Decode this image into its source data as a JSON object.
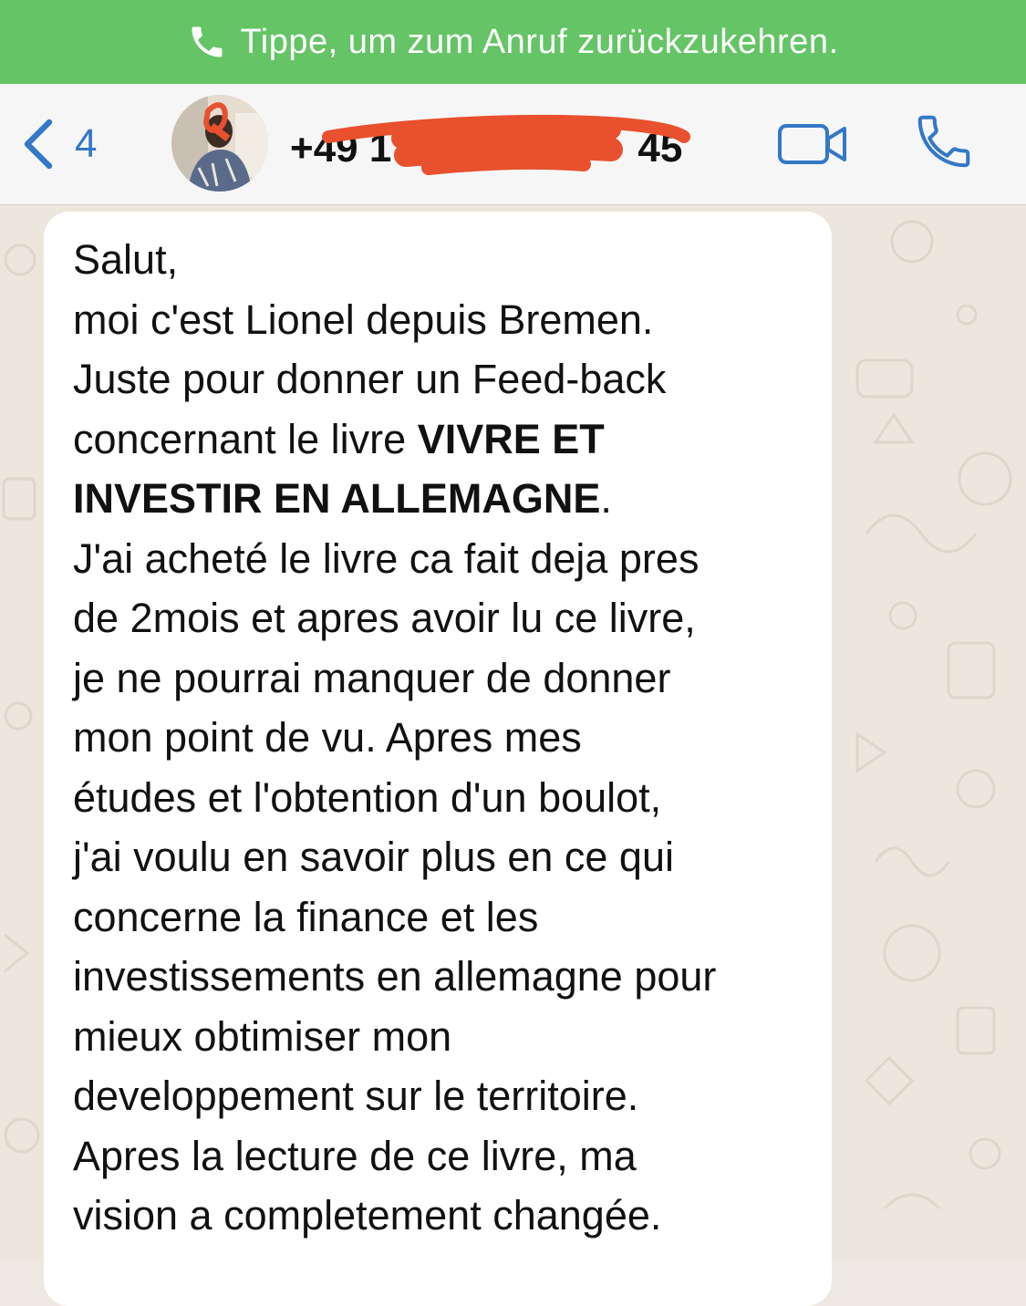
{
  "call_banner": {
    "text": "Tippe, um zum Anruf zurückzukehren.",
    "icon": "phone-icon"
  },
  "header": {
    "back_count": "4",
    "contact_visible": "+49 15… …45",
    "contact_prefix": "+49 1",
    "contact_suffix": "45",
    "contact_redacted": true,
    "video_icon": "video-camera-icon",
    "call_icon": "phone-icon",
    "accent_color": "#3478c6"
  },
  "message": {
    "line1": "Salut,",
    "line2": "moi c'est Lionel depuis Bremen.",
    "line3": "Juste pour donner un Feed-back",
    "line4_pre": "concernant le livre ",
    "line4_bold": "VIVRE ET",
    "line5_bold": "INVESTIR EN ALLEMAGNE",
    "line5_post": ".",
    "line6": "J'ai acheté le livre ca fait deja pres",
    "line7": "de 2mois et apres avoir lu ce livre,",
    "line8": "je ne pourrai manquer de donner",
    "line9": "mon point de vu. Apres mes",
    "line10": "études et l'obtention d'un boulot,",
    "line11": "j'ai voulu en savoir plus en ce qui",
    "line12": "concerne la finance et les",
    "line13": "investissements en allemagne pour",
    "line14": "mieux obtimiser mon",
    "line15": "developpement sur le territoire.",
    "line16": "Apres la lecture de ce livre, ma",
    "line17": "vision a completement changée."
  },
  "colors": {
    "banner_green": "#65c466",
    "redaction": "#e8502e"
  }
}
